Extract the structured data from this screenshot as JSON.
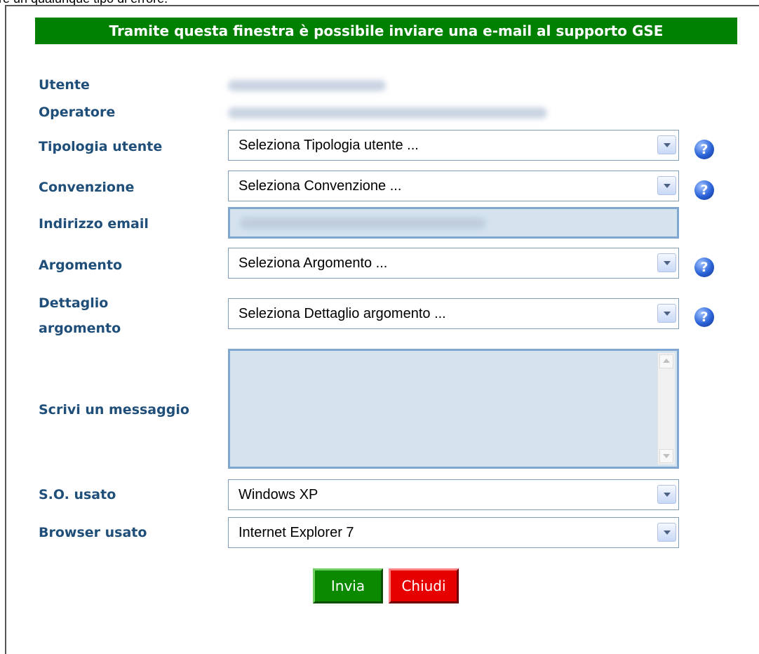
{
  "intro_text": "re un qualunque tipo di errore.",
  "banner": "Tramite questa finestra è possibile inviare una e-mail al supporto GSE",
  "labels": {
    "utente": "Utente",
    "operatore": "Operatore",
    "tipologia_utente": "Tipologia utente",
    "convenzione": "Convenzione",
    "indirizzo_email": "Indirizzo email",
    "argomento": "Argomento",
    "dettaglio_line1": "Dettaglio",
    "dettaglio_line2": "argomento",
    "messaggio": "Scrivi un messaggio",
    "so_usato": "S.O. usato",
    "browser_usato": "Browser usato"
  },
  "selects": {
    "tipologia_utente": "Seleziona Tipologia utente ...",
    "convenzione": "Seleziona Convenzione ...",
    "argomento": "Seleziona Argomento ...",
    "dettaglio_argomento": "Seleziona Dettaglio argomento ...",
    "so_usato": "Windows XP",
    "browser_usato": "Internet Explorer 7"
  },
  "help_glyph": "?",
  "buttons": {
    "send": "Invia",
    "close": "Chiudi"
  },
  "colors": {
    "banner": "#008000",
    "label": "#1f4e79",
    "send": "#0b8a00",
    "close": "#e60000",
    "field_bg": "#d4e3ee"
  },
  "icons": [
    "help-icon",
    "dropdown-arrow-icon",
    "scroll-up-icon",
    "scroll-down-icon"
  ]
}
